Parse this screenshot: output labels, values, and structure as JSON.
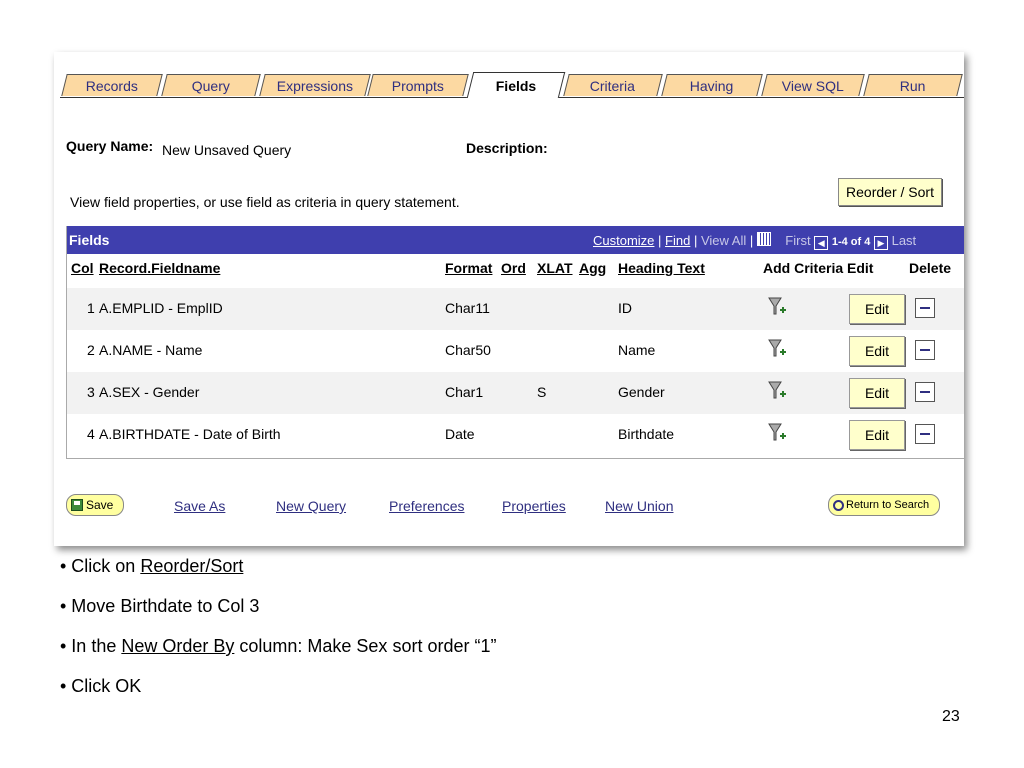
{
  "tabs": [
    "Records",
    "Query",
    "Expressions",
    "Prompts",
    "Fields",
    "Criteria",
    "Having",
    "View SQL",
    "Run"
  ],
  "active_tab": "Fields",
  "query_name_label": "Query Name:",
  "query_name_value": "New Unsaved Query",
  "description_label": "Description:",
  "instructions": "View field properties, or use field as criteria in query statement.",
  "reorder_button": "Reorder / Sort",
  "grid": {
    "title": "Fields",
    "customize": "Customize",
    "sep1": " | ",
    "find": "Find",
    "sep2": " | ",
    "view_all": "View All",
    "sep3": " | ",
    "first": "First",
    "range": "1-4 of 4",
    "last": "Last",
    "headers": {
      "col": "Col",
      "fieldname": "Record.Fieldname",
      "format": "Format",
      "ord": "Ord",
      "xlat": "XLAT",
      "agg": "Agg",
      "heading": "Heading Text",
      "add_criteria": "Add Criteria",
      "edit": "Edit",
      "delete": "Delete"
    },
    "rows": [
      {
        "col": "1",
        "field": "A.EMPLID - EmplID",
        "format": "Char11",
        "xlat": "",
        "heading": "ID",
        "edit": "Edit"
      },
      {
        "col": "2",
        "field": "A.NAME - Name",
        "format": "Char50",
        "xlat": "",
        "heading": "Name",
        "edit": "Edit"
      },
      {
        "col": "3",
        "field": "A.SEX - Gender",
        "format": "Char1",
        "xlat": "S",
        "heading": "Gender",
        "edit": "Edit"
      },
      {
        "col": "4",
        "field": "A.BIRTHDATE - Date of Birth",
        "format": "Date",
        "xlat": "",
        "heading": "Birthdate",
        "edit": "Edit"
      }
    ]
  },
  "footer": {
    "save": "Save",
    "save_as": "Save As",
    "new_query": "New Query",
    "preferences": "Preferences",
    "properties": "Properties",
    "new_union": "New Union",
    "return_to_search": "Return to Search"
  },
  "bullets": {
    "b1_prefix": "• Click on ",
    "b1_link": "Reorder/Sort",
    "b2": "• Move Birthdate to Col 3",
    "b3_prefix": "• In the ",
    "b3_link": "New Order By",
    "b3_mid": " column:   Make Sex sort order “1”",
    "b4": "• Click OK"
  },
  "page_number": "23"
}
